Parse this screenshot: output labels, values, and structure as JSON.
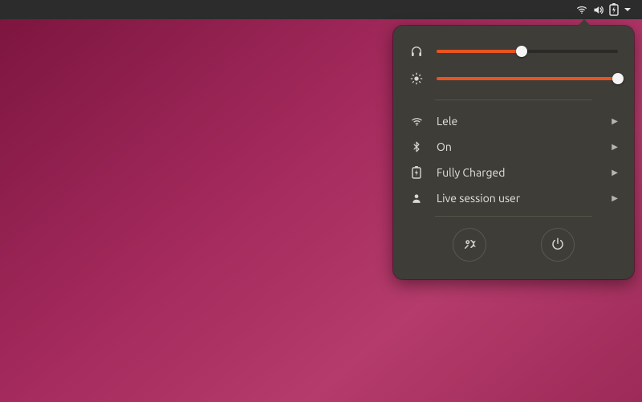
{
  "accent_color": "#e95420",
  "sliders": {
    "volume_percent": 47,
    "brightness_percent": 100
  },
  "menu": {
    "wifi": {
      "label": "Lele"
    },
    "bluetooth": {
      "label": "On"
    },
    "battery": {
      "label": "Fully Charged"
    },
    "user": {
      "label": "Live session user"
    }
  }
}
